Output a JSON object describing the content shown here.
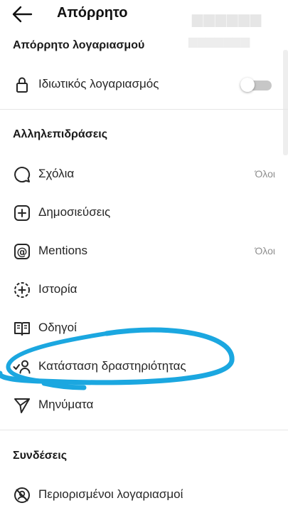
{
  "header": {
    "title": "Απόρρητο",
    "back_icon": "arrow-left-icon"
  },
  "sections": {
    "account_privacy": "Απόρρητο λογαριασμού",
    "interactions": "Αλληλεπιδράσεις",
    "connections": "Συνδέσεις"
  },
  "private_account": {
    "label": "Ιδιωτικός λογαριασμός",
    "icon": "lock-icon",
    "enabled": false
  },
  "interactions": [
    {
      "label": "Σχόλια",
      "value": "Όλοι",
      "icon": "comment-icon"
    },
    {
      "label": "Δημοσιεύσεις",
      "value": "",
      "icon": "add-post-icon"
    },
    {
      "label": "Mentions",
      "value": "Όλοι",
      "icon": "at-sign-icon"
    },
    {
      "label": "Ιστορία",
      "value": "",
      "icon": "story-icon"
    },
    {
      "label": "Οδηγοί",
      "value": "",
      "icon": "guides-icon"
    },
    {
      "label": "Κατάσταση δραστηριότητας",
      "value": "",
      "icon": "activity-status-icon"
    },
    {
      "label": "Μηνύματα",
      "value": "",
      "icon": "send-icon"
    }
  ],
  "connections": [
    {
      "label": "Περιορισμένοι λογαριασμοί",
      "icon": "restricted-icon"
    }
  ],
  "colors": {
    "annotation_marker": "#1ba7e0",
    "toggle_off": "#c7c7c7",
    "value_text": "#8e8e8e"
  }
}
